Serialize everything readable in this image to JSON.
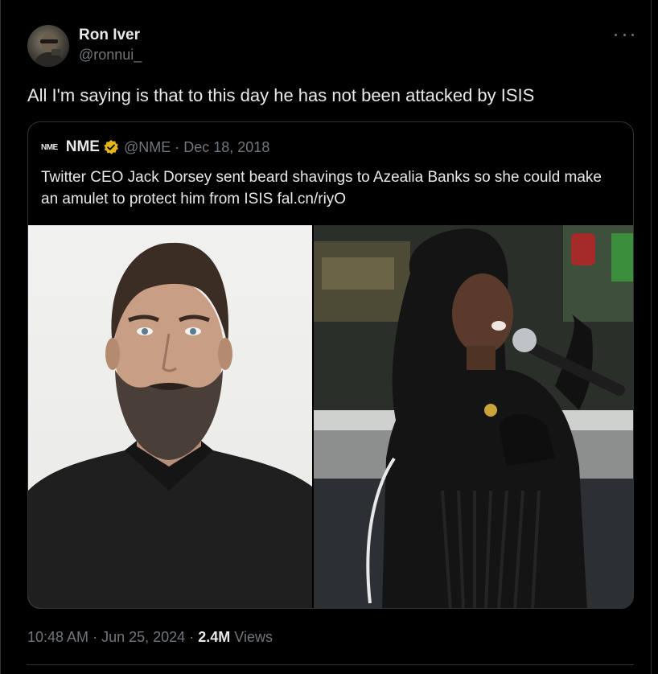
{
  "author": {
    "name": "Ron Iver",
    "handle": "@ronnui_"
  },
  "tweet": {
    "text": "All I'm saying is that to this day he has not been attacked by ISIS"
  },
  "quoted": {
    "logo_text": "NME",
    "name": "NME",
    "handle": "@NME",
    "separator": "·",
    "date": "Dec 18, 2018",
    "text": "Twitter CEO Jack Dorsey sent beard shavings to Azealia Banks so she could make an amulet to protect him from ISIS fal.cn/riyO",
    "images": [
      {
        "description_icon": "portrait-photo"
      },
      {
        "description_icon": "performer-photo"
      }
    ]
  },
  "meta": {
    "time": "10:48 AM",
    "separator": "·",
    "date": "Jun 25, 2024",
    "views_count": "2.4M",
    "views_label": "Views"
  },
  "colors": {
    "background": "#000000",
    "text_primary": "#e7e9ea",
    "text_secondary": "#71767b",
    "border": "#2f3336",
    "verified_gold": "#e2b719"
  }
}
